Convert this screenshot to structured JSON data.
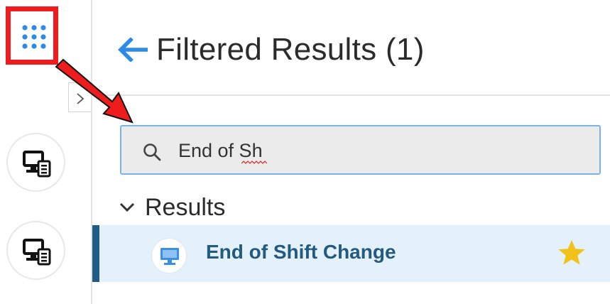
{
  "header": {
    "title": "Filtered Results (1)",
    "back_icon": "arrow-left-icon"
  },
  "search": {
    "value": "End of Sh",
    "icon": "search-icon"
  },
  "results": {
    "section_label": "Results",
    "items": [
      {
        "label": "End of Shift Change",
        "icon": "monitor-icon",
        "favorite": true
      }
    ]
  },
  "rail": {
    "apps_icon": "grid-dots-icon",
    "collapse_icon": "chevron-right-icon",
    "apps": [
      {
        "icon": "monitor-document-icon"
      },
      {
        "icon": "monitor-document-icon"
      }
    ]
  },
  "colors": {
    "accent_blue": "#2c8be6",
    "annotation_red": "#ee1c1c",
    "selected_row": "#e4f1fa",
    "row_accent": "#1f5d87",
    "result_text": "#235a80",
    "star": "#f2c21b"
  }
}
